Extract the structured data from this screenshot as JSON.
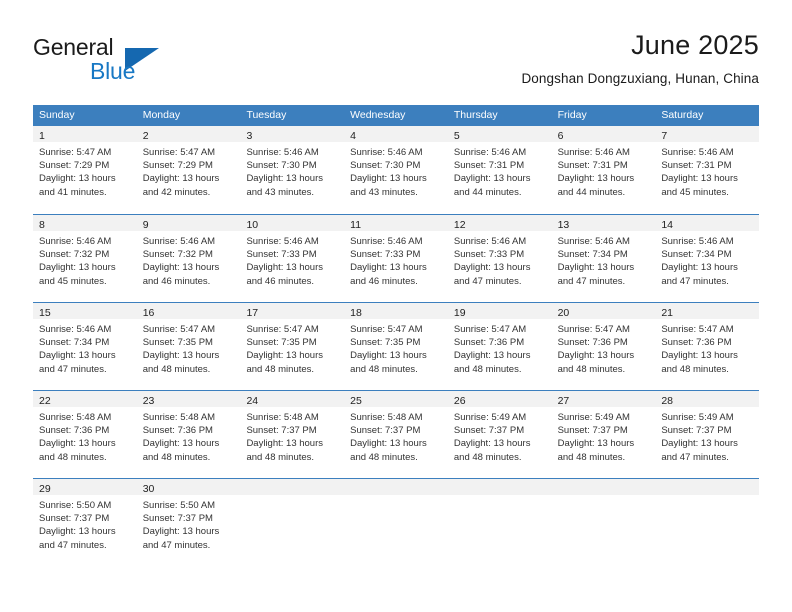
{
  "brand": {
    "name_part1": "General",
    "name_part2": "Blue",
    "accent_color": "#1878c4"
  },
  "header": {
    "title": "June 2025",
    "location": "Dongshan Dongzuxiang, Hunan, China"
  },
  "calendar": {
    "header_color": "#3c7fbe",
    "weekdays": [
      "Sunday",
      "Monday",
      "Tuesday",
      "Wednesday",
      "Thursday",
      "Friday",
      "Saturday"
    ],
    "weeks": [
      [
        {
          "day": "1",
          "sunrise": "Sunrise: 5:47 AM",
          "sunset": "Sunset: 7:29 PM",
          "daylight_line1": "Daylight: 13 hours",
          "daylight_line2": "and 41 minutes."
        },
        {
          "day": "2",
          "sunrise": "Sunrise: 5:47 AM",
          "sunset": "Sunset: 7:29 PM",
          "daylight_line1": "Daylight: 13 hours",
          "daylight_line2": "and 42 minutes."
        },
        {
          "day": "3",
          "sunrise": "Sunrise: 5:46 AM",
          "sunset": "Sunset: 7:30 PM",
          "daylight_line1": "Daylight: 13 hours",
          "daylight_line2": "and 43 minutes."
        },
        {
          "day": "4",
          "sunrise": "Sunrise: 5:46 AM",
          "sunset": "Sunset: 7:30 PM",
          "daylight_line1": "Daylight: 13 hours",
          "daylight_line2": "and 43 minutes."
        },
        {
          "day": "5",
          "sunrise": "Sunrise: 5:46 AM",
          "sunset": "Sunset: 7:31 PM",
          "daylight_line1": "Daylight: 13 hours",
          "daylight_line2": "and 44 minutes."
        },
        {
          "day": "6",
          "sunrise": "Sunrise: 5:46 AM",
          "sunset": "Sunset: 7:31 PM",
          "daylight_line1": "Daylight: 13 hours",
          "daylight_line2": "and 44 minutes."
        },
        {
          "day": "7",
          "sunrise": "Sunrise: 5:46 AM",
          "sunset": "Sunset: 7:31 PM",
          "daylight_line1": "Daylight: 13 hours",
          "daylight_line2": "and 45 minutes."
        }
      ],
      [
        {
          "day": "8",
          "sunrise": "Sunrise: 5:46 AM",
          "sunset": "Sunset: 7:32 PM",
          "daylight_line1": "Daylight: 13 hours",
          "daylight_line2": "and 45 minutes."
        },
        {
          "day": "9",
          "sunrise": "Sunrise: 5:46 AM",
          "sunset": "Sunset: 7:32 PM",
          "daylight_line1": "Daylight: 13 hours",
          "daylight_line2": "and 46 minutes."
        },
        {
          "day": "10",
          "sunrise": "Sunrise: 5:46 AM",
          "sunset": "Sunset: 7:33 PM",
          "daylight_line1": "Daylight: 13 hours",
          "daylight_line2": "and 46 minutes."
        },
        {
          "day": "11",
          "sunrise": "Sunrise: 5:46 AM",
          "sunset": "Sunset: 7:33 PM",
          "daylight_line1": "Daylight: 13 hours",
          "daylight_line2": "and 46 minutes."
        },
        {
          "day": "12",
          "sunrise": "Sunrise: 5:46 AM",
          "sunset": "Sunset: 7:33 PM",
          "daylight_line1": "Daylight: 13 hours",
          "daylight_line2": "and 47 minutes."
        },
        {
          "day": "13",
          "sunrise": "Sunrise: 5:46 AM",
          "sunset": "Sunset: 7:34 PM",
          "daylight_line1": "Daylight: 13 hours",
          "daylight_line2": "and 47 minutes."
        },
        {
          "day": "14",
          "sunrise": "Sunrise: 5:46 AM",
          "sunset": "Sunset: 7:34 PM",
          "daylight_line1": "Daylight: 13 hours",
          "daylight_line2": "and 47 minutes."
        }
      ],
      [
        {
          "day": "15",
          "sunrise": "Sunrise: 5:46 AM",
          "sunset": "Sunset: 7:34 PM",
          "daylight_line1": "Daylight: 13 hours",
          "daylight_line2": "and 47 minutes."
        },
        {
          "day": "16",
          "sunrise": "Sunrise: 5:47 AM",
          "sunset": "Sunset: 7:35 PM",
          "daylight_line1": "Daylight: 13 hours",
          "daylight_line2": "and 48 minutes."
        },
        {
          "day": "17",
          "sunrise": "Sunrise: 5:47 AM",
          "sunset": "Sunset: 7:35 PM",
          "daylight_line1": "Daylight: 13 hours",
          "daylight_line2": "and 48 minutes."
        },
        {
          "day": "18",
          "sunrise": "Sunrise: 5:47 AM",
          "sunset": "Sunset: 7:35 PM",
          "daylight_line1": "Daylight: 13 hours",
          "daylight_line2": "and 48 minutes."
        },
        {
          "day": "19",
          "sunrise": "Sunrise: 5:47 AM",
          "sunset": "Sunset: 7:36 PM",
          "daylight_line1": "Daylight: 13 hours",
          "daylight_line2": "and 48 minutes."
        },
        {
          "day": "20",
          "sunrise": "Sunrise: 5:47 AM",
          "sunset": "Sunset: 7:36 PM",
          "daylight_line1": "Daylight: 13 hours",
          "daylight_line2": "and 48 minutes."
        },
        {
          "day": "21",
          "sunrise": "Sunrise: 5:47 AM",
          "sunset": "Sunset: 7:36 PM",
          "daylight_line1": "Daylight: 13 hours",
          "daylight_line2": "and 48 minutes."
        }
      ],
      [
        {
          "day": "22",
          "sunrise": "Sunrise: 5:48 AM",
          "sunset": "Sunset: 7:36 PM",
          "daylight_line1": "Daylight: 13 hours",
          "daylight_line2": "and 48 minutes."
        },
        {
          "day": "23",
          "sunrise": "Sunrise: 5:48 AM",
          "sunset": "Sunset: 7:36 PM",
          "daylight_line1": "Daylight: 13 hours",
          "daylight_line2": "and 48 minutes."
        },
        {
          "day": "24",
          "sunrise": "Sunrise: 5:48 AM",
          "sunset": "Sunset: 7:37 PM",
          "daylight_line1": "Daylight: 13 hours",
          "daylight_line2": "and 48 minutes."
        },
        {
          "day": "25",
          "sunrise": "Sunrise: 5:48 AM",
          "sunset": "Sunset: 7:37 PM",
          "daylight_line1": "Daylight: 13 hours",
          "daylight_line2": "and 48 minutes."
        },
        {
          "day": "26",
          "sunrise": "Sunrise: 5:49 AM",
          "sunset": "Sunset: 7:37 PM",
          "daylight_line1": "Daylight: 13 hours",
          "daylight_line2": "and 48 minutes."
        },
        {
          "day": "27",
          "sunrise": "Sunrise: 5:49 AM",
          "sunset": "Sunset: 7:37 PM",
          "daylight_line1": "Daylight: 13 hours",
          "daylight_line2": "and 48 minutes."
        },
        {
          "day": "28",
          "sunrise": "Sunrise: 5:49 AM",
          "sunset": "Sunset: 7:37 PM",
          "daylight_line1": "Daylight: 13 hours",
          "daylight_line2": "and 47 minutes."
        }
      ],
      [
        {
          "day": "29",
          "sunrise": "Sunrise: 5:50 AM",
          "sunset": "Sunset: 7:37 PM",
          "daylight_line1": "Daylight: 13 hours",
          "daylight_line2": "and 47 minutes."
        },
        {
          "day": "30",
          "sunrise": "Sunrise: 5:50 AM",
          "sunset": "Sunset: 7:37 PM",
          "daylight_line1": "Daylight: 13 hours",
          "daylight_line2": "and 47 minutes."
        },
        {
          "day": "",
          "sunrise": "",
          "sunset": "",
          "daylight_line1": "",
          "daylight_line2": ""
        },
        {
          "day": "",
          "sunrise": "",
          "sunset": "",
          "daylight_line1": "",
          "daylight_line2": ""
        },
        {
          "day": "",
          "sunrise": "",
          "sunset": "",
          "daylight_line1": "",
          "daylight_line2": ""
        },
        {
          "day": "",
          "sunrise": "",
          "sunset": "",
          "daylight_line1": "",
          "daylight_line2": ""
        },
        {
          "day": "",
          "sunrise": "",
          "sunset": "",
          "daylight_line1": "",
          "daylight_line2": ""
        }
      ]
    ]
  }
}
